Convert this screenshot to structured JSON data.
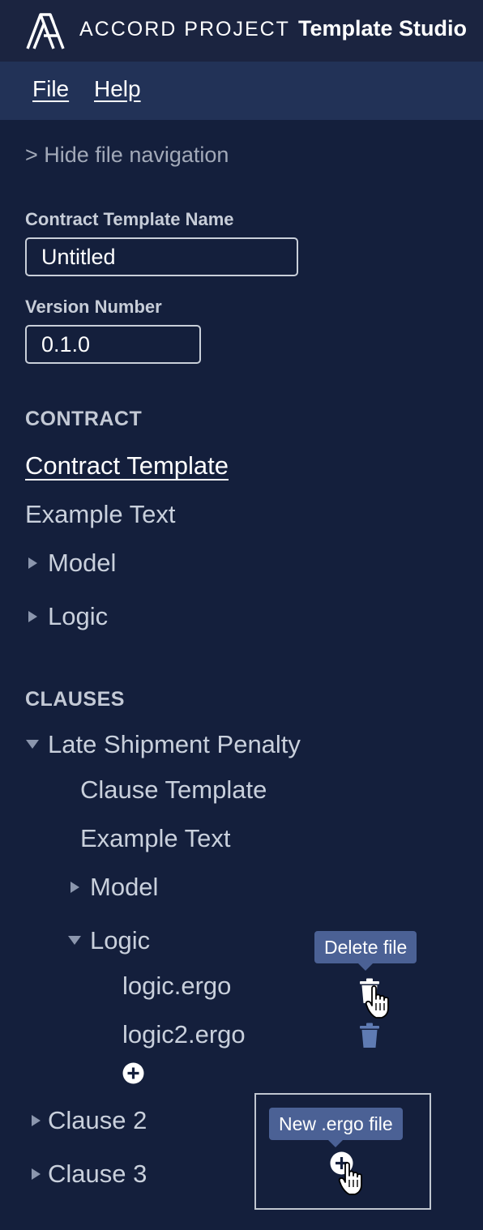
{
  "header": {
    "brand": "ACCORD PROJECT",
    "app_title": "Template Studio",
    "logo_icon": "accord-project-logo"
  },
  "menu": {
    "file": "File",
    "help": "Help"
  },
  "sidebar": {
    "hide_nav": "> Hide file navigation",
    "template_name_label": "Contract Template Name",
    "template_name_value": "Untitled",
    "version_label": "Version Number",
    "version_value": "0.1.0",
    "contract_heading": "CONTRACT",
    "contract_items": {
      "contract_template": "Contract Template",
      "example_text": "Example Text",
      "model": "Model",
      "logic": "Logic"
    },
    "clauses_heading": "CLAUSES",
    "clause1": {
      "name": "Late Shipment Penalty",
      "clause_template": "Clause Template",
      "example_text": "Example Text",
      "model": "Model",
      "logic": "Logic",
      "files": [
        "logic.ergo",
        "logic2.ergo"
      ]
    },
    "clause2": "Clause 2",
    "clause3": "Clause 3"
  },
  "tooltips": {
    "delete_file": "Delete file",
    "new_ergo_file": "New .ergo file"
  },
  "colors": {
    "background": "#141f3c",
    "topbar": "#1b2440",
    "menubar": "#223257",
    "tooltip": "#4b6195",
    "icon": "#5f7bb3"
  }
}
